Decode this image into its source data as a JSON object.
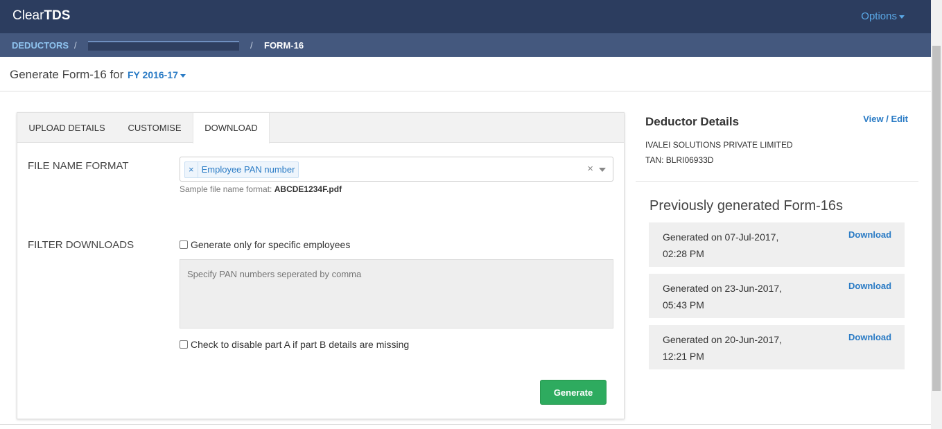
{
  "app": {
    "logo_light": "Clear",
    "logo_bold": "TDS",
    "options_label": "Options"
  },
  "breadcrumb": {
    "deductors": "DEDUCTORS",
    "separator": "/",
    "current": "FORM-16"
  },
  "subheader": {
    "label": "Generate Form-16 for",
    "fy": "FY 2016-17"
  },
  "tabs": [
    {
      "label": "UPLOAD DETAILS"
    },
    {
      "label": "CUSTOMISE"
    },
    {
      "label": "DOWNLOAD"
    }
  ],
  "file_format": {
    "label": "FILE NAME FORMAT",
    "chip_remove": "×",
    "chip": "Employee PAN number",
    "clear": "×",
    "sample_prefix": "Sample file name format:",
    "sample_value": "ABCDE1234F.pdf"
  },
  "filter": {
    "label": "FILTER DOWNLOADS",
    "specific_label": "Generate only for specific employees",
    "pan_placeholder": "Specify PAN numbers seperated by comma",
    "disable_label": "Check to disable part A if part B details are missing"
  },
  "generate_label": "Generate",
  "deductor": {
    "title": "Deductor Details",
    "edit_label": "View / Edit",
    "name": "IVALEI SOLUTIONS PRIVATE LIMITED",
    "tan": "TAN: BLRI06933D"
  },
  "previous": {
    "title": "Previously generated Form-16s",
    "items": [
      {
        "line1": "Generated on 07-Jul-2017,",
        "line2": "02:28 PM",
        "download": "Download"
      },
      {
        "line1": "Generated on 23-Jun-2017,",
        "line2": "05:43 PM",
        "download": "Download"
      },
      {
        "line1": "Generated on 20-Jun-2017,",
        "line2": "12:21 PM",
        "download": "Download"
      }
    ]
  },
  "colors": {
    "topbar": "#2c3d5f",
    "breadcrumb": "#44587e",
    "accent": "#2a7bc5",
    "generate": "#2eab5f"
  }
}
